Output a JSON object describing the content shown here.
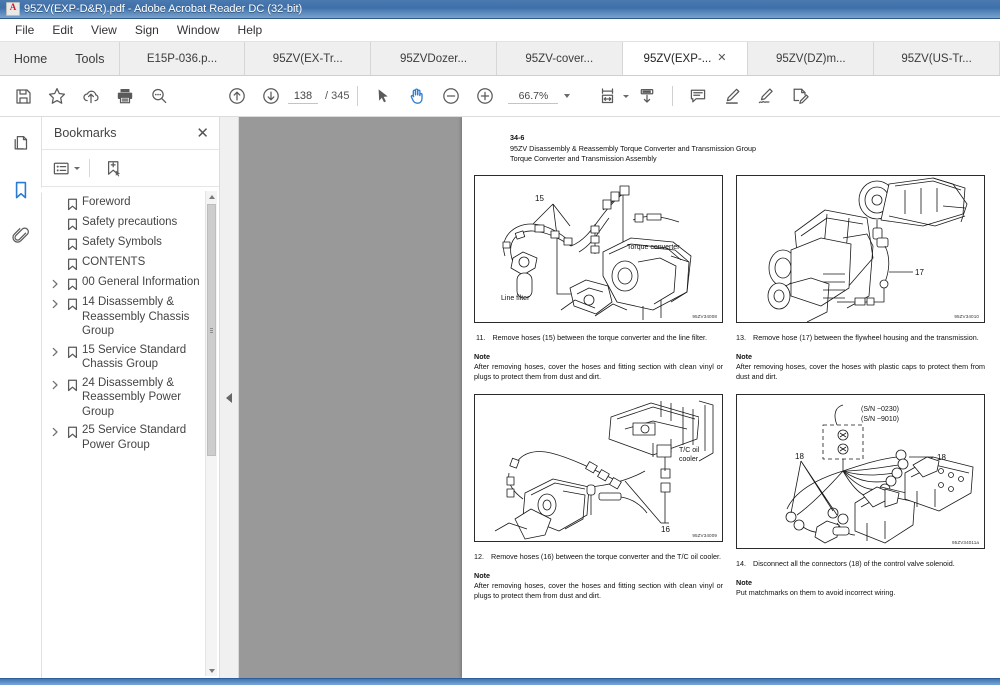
{
  "window": {
    "title": "95ZV(EXP-D&R).pdf - Adobe Acrobat Reader DC (32-bit)",
    "app_icon": "acrobat-icon"
  },
  "menubar": {
    "items": [
      "File",
      "Edit",
      "View",
      "Sign",
      "Window",
      "Help"
    ]
  },
  "tabs": {
    "home_label": "Home",
    "tools_label": "Tools",
    "close_glyph": "✕",
    "documents": [
      {
        "label": "E15P-036.p...",
        "active": false
      },
      {
        "label": "95ZV(EX-Tr...",
        "active": false
      },
      {
        "label": "95ZVDozer...",
        "active": false
      },
      {
        "label": "95ZV-cover...",
        "active": false
      },
      {
        "label": "95ZV(EXP-...",
        "active": true
      },
      {
        "label": "95ZV(DZ)m...",
        "active": false
      },
      {
        "label": "95ZV(US-Tr...",
        "active": false
      }
    ]
  },
  "toolbar": {
    "save_label": "save-icon",
    "star_label": "add-to-favorites-icon",
    "cloud_label": "upload-to-cloud-icon",
    "print_label": "print-icon",
    "find_label": "find-icon",
    "prev_page_label": "previous-page-icon",
    "next_page_label": "next-page-icon",
    "page_number": "138",
    "page_total": "/ 345",
    "select_tool_label": "select-tool-icon",
    "hand_tool_label": "hand-tool-icon",
    "zoom_out_label": "zoom-out-icon",
    "zoom_in_label": "zoom-in-icon",
    "zoom_value": "66.7%",
    "fit_page_label": "fit-page-icon",
    "scroll_mode_label": "page-display-icon",
    "comment_label": "add-comment-icon",
    "highlight_label": "highlight-text-icon",
    "sign_label": "sign-icon",
    "stamp_label": "stamp-icon"
  },
  "rail": {
    "items": [
      {
        "name": "page-thumbnails",
        "selected": false
      },
      {
        "name": "bookmarks",
        "selected": true
      },
      {
        "name": "attachments",
        "selected": false
      }
    ]
  },
  "bookmarks_panel": {
    "title": "Bookmarks",
    "close_glyph": "✕",
    "options_label": "bookmark-options",
    "new_bookmark_label": "new-bookmark",
    "items": [
      {
        "label": "Foreword",
        "expandable": false
      },
      {
        "label": "Safety precautions",
        "expandable": false
      },
      {
        "label": "Safety Symbols",
        "expandable": false
      },
      {
        "label": "CONTENTS",
        "expandable": false
      },
      {
        "label": "00 General Information",
        "expandable": true
      },
      {
        "label": "14 Disassembly & Reassembly Chassis Group",
        "expandable": true
      },
      {
        "label": "15 Service Standard Chassis Group",
        "expandable": true
      },
      {
        "label": "24 Disassembly & Reassembly Power Group",
        "expandable": true
      },
      {
        "label": "25 Service Standard Power Group",
        "expandable": true
      }
    ]
  },
  "splitter": {
    "collapse_glyph": "◀"
  },
  "document": {
    "header": {
      "page_ref": "34-6",
      "line1": "95ZV Disassembly & Reassembly Torque Converter and Transmission Group",
      "line2": "Torque Converter and Transmission Assembly"
    },
    "figures": [
      {
        "id": "fig-torque-converter-line-filter",
        "code": "95ZV34008",
        "callouts": [
          "15"
        ],
        "labels": [
          "Torque converter",
          "Line filter"
        ]
      },
      {
        "id": "fig-flywheel-housing-transmission",
        "code": "95ZV34010",
        "callouts": [
          "17"
        ],
        "labels": []
      },
      {
        "id": "fig-tc-oil-cooler",
        "code": "95ZV34009",
        "callouts": [
          "16"
        ],
        "labels": [
          "T/C oil cooler"
        ]
      },
      {
        "id": "fig-control-valve-solenoid",
        "code": "95ZV34011a",
        "callouts": [
          "18",
          "18"
        ],
        "labels": [
          "(S/N ~0230)",
          "(S/N ~9010)"
        ]
      }
    ],
    "steps": [
      {
        "number": "11.",
        "text": "Remove hoses (15) between the torque converter and the line filter.",
        "note_heading": "Note",
        "note_text": "After removing hoses, cover the hoses and fitting section with clean vinyl or plugs to protect them from dust and dirt."
      },
      {
        "number": "13.",
        "text": "Remove hose (17) between the flywheel housing and the transmission.",
        "note_heading": "Note",
        "note_text": "After removing hoses, cover the hoses with plastic caps to protect them from dust and dirt."
      },
      {
        "number": "12.",
        "text": "Remove hoses (16) between the torque converter and the T/C oil cooler.",
        "note_heading": "Note",
        "note_text": "After removing hoses, cover the hoses and fitting section with clean vinyl or plugs to protect them from dust and dirt."
      },
      {
        "number": "14.",
        "text": "Disconnect all the connectors (18) of the control valve solenoid.",
        "note_heading": "Note",
        "note_text": "Put matchmarks on them to avoid incorrect wiring."
      }
    ]
  },
  "colors": {
    "titlebar": "#4a7ab0",
    "accent": "#2b7bd4",
    "viewport_bg": "#999999",
    "tab_strip": "#efefef"
  }
}
